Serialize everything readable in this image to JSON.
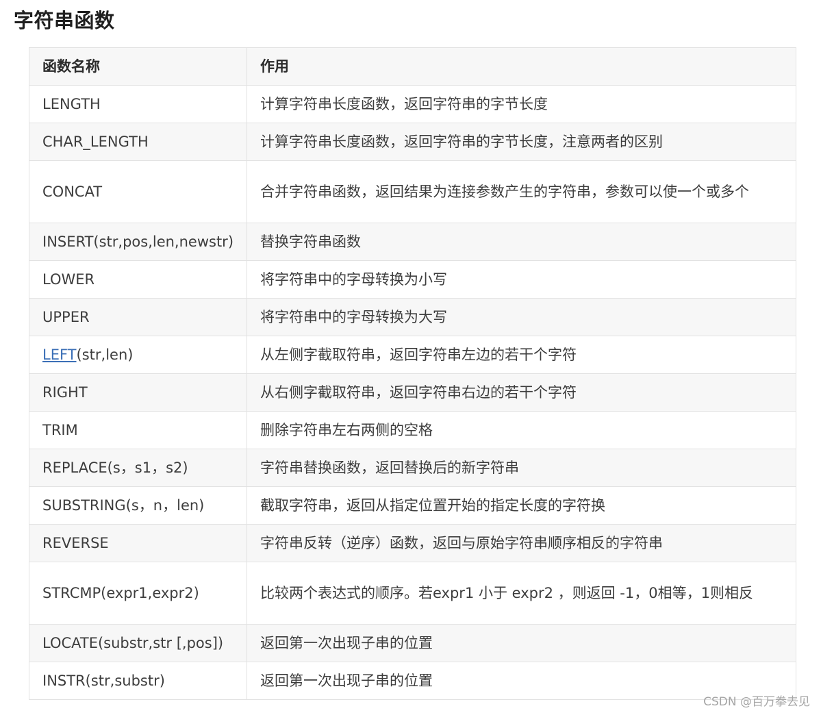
{
  "section_title": "字符串函数",
  "table": {
    "headers": {
      "name": "函数名称",
      "purpose": "作用"
    },
    "rows": [
      {
        "name": "LENGTH",
        "purpose": "计算字符串长度函数，返回字符串的字节长度"
      },
      {
        "name": "CHAR_LENGTH",
        "purpose": "计算字符串长度函数，返回字符串的字节长度，注意两者的区别"
      },
      {
        "name": "CONCAT",
        "purpose": "合并字符串函数，返回结果为连接参数产生的字符串，参数可以使一个或多个"
      },
      {
        "name": "INSERT(str,pos,len,newstr)",
        "purpose": "替换字符串函数"
      },
      {
        "name": "LOWER",
        "purpose": "将字符串中的字母转换为小写"
      },
      {
        "name": "UPPER",
        "purpose": "将字符串中的字母转换为大写"
      },
      {
        "name_link": "LEFT",
        "name_rest": "(str,len)",
        "purpose": "从左侧字截取符串，返回字符串左边的若干个字符"
      },
      {
        "name": "RIGHT",
        "purpose": "从右侧字截取符串，返回字符串右边的若干个字符"
      },
      {
        "name": "TRIM",
        "purpose": "删除字符串左右两侧的空格"
      },
      {
        "name": "REPLACE(s，s1，s2)",
        "purpose": "字符串替换函数，返回替换后的新字符串"
      },
      {
        "name": "SUBSTRING(s，n，len)",
        "purpose": "截取字符串，返回从指定位置开始的指定长度的字符换"
      },
      {
        "name": "REVERSE",
        "purpose": "字符串反转（逆序）函数，返回与原始字符串顺序相反的字符串"
      },
      {
        "name": "STRCMP(expr1,expr2)",
        "purpose": "比较两个表达式的顺序。若expr1 小于 expr2 ，则返回 -1，0相等，1则相反"
      },
      {
        "name": "LOCATE(substr,str [,pos])",
        "purpose": "返回第一次出现子串的位置"
      },
      {
        "name": "INSTR(str,substr)",
        "purpose": "返回第一次出现子串的位置"
      }
    ]
  },
  "watermark": "CSDN @百万拳去见"
}
